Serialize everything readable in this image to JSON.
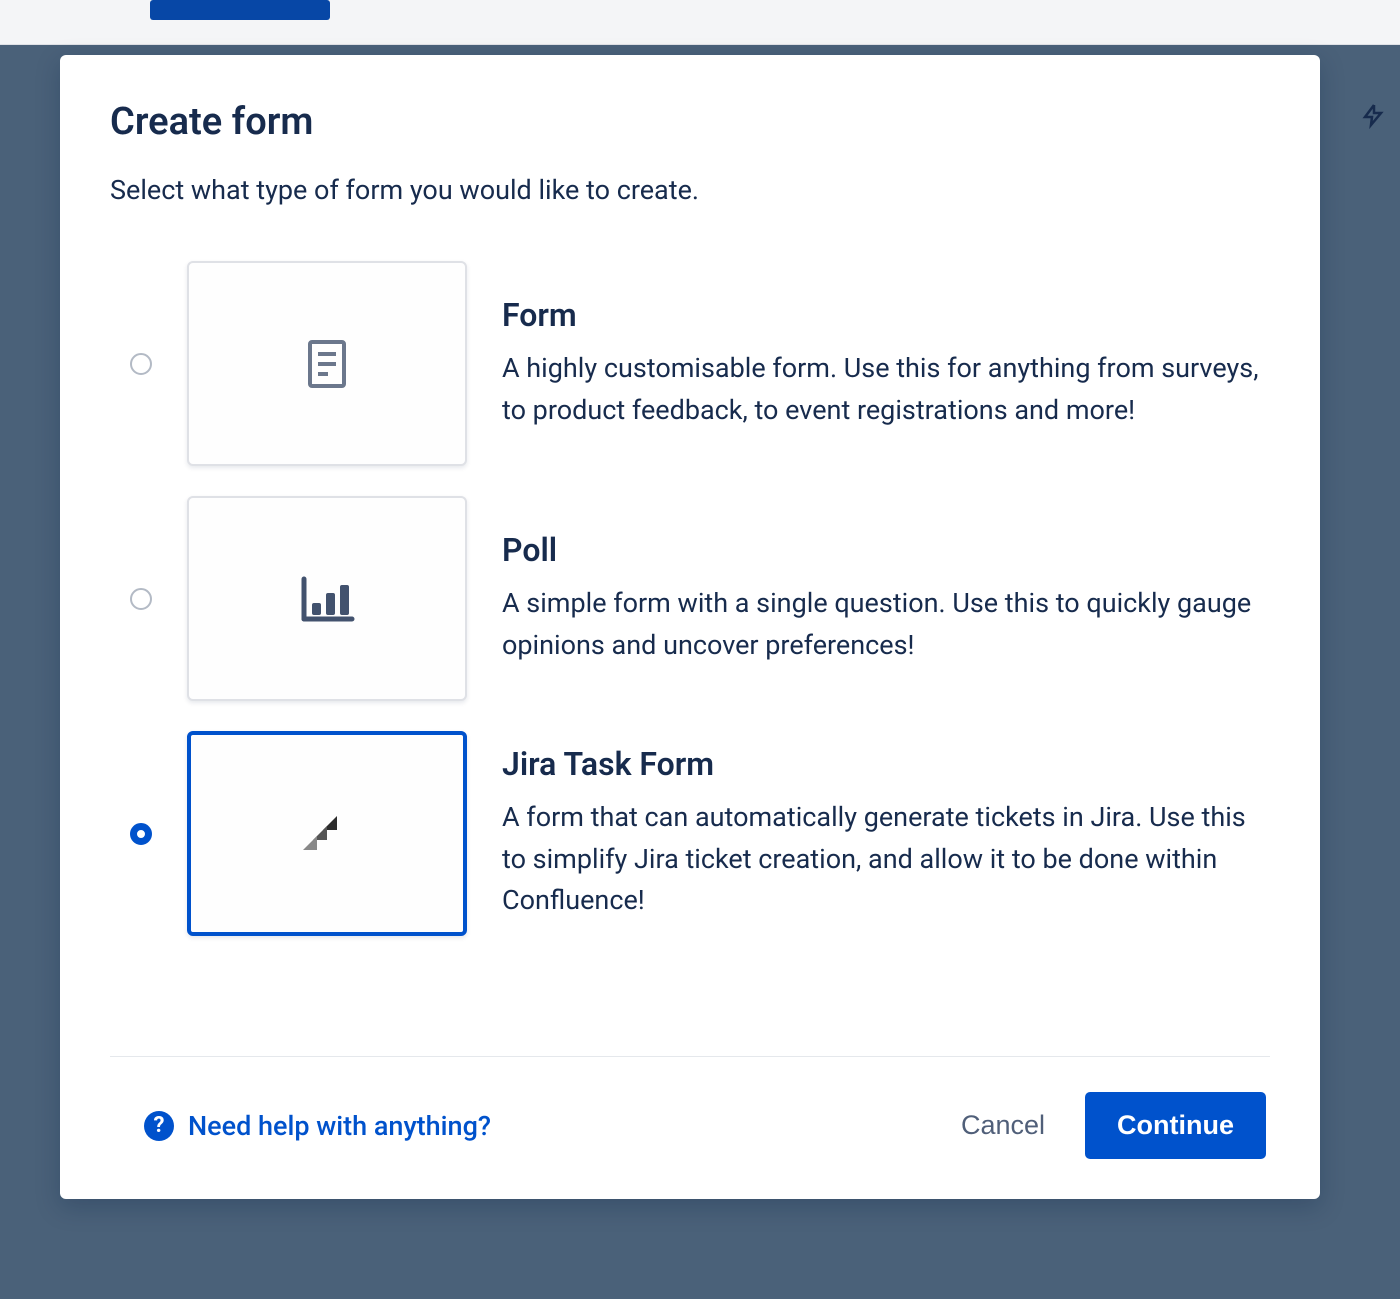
{
  "modal": {
    "title": "Create form",
    "subtitle": "Select what type of form you would like to create.",
    "options": [
      {
        "key": "form",
        "title": "Form",
        "description": "A highly customisable form. Use this for anything from surveys, to product feedback, to event registrations and more!",
        "selected": false,
        "icon": "document-icon"
      },
      {
        "key": "poll",
        "title": "Poll",
        "description": "A simple form with a single question. Use this to quickly gauge opinions and uncover preferences!",
        "selected": false,
        "icon": "bar-chart-icon"
      },
      {
        "key": "jira",
        "title": "Jira Task Form",
        "description": "A form that can automatically generate tickets in Jira. Use this to simplify Jira ticket creation, and allow it to be done within Confluence!",
        "selected": true,
        "icon": "jira-icon"
      }
    ],
    "footer": {
      "help_label": "Need help with anything?",
      "cancel_label": "Cancel",
      "continue_label": "Continue"
    }
  }
}
